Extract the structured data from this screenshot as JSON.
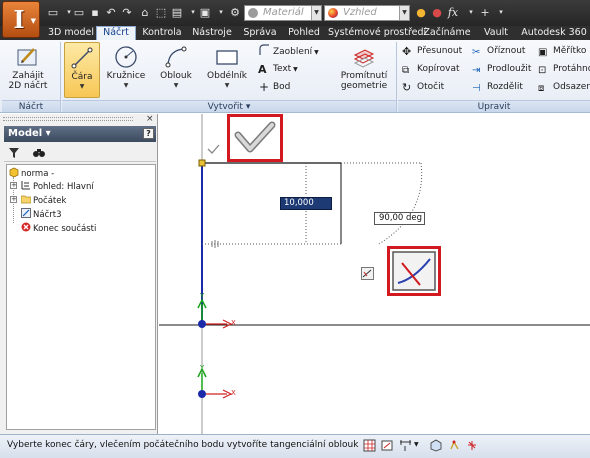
{
  "quick_access": {
    "app_logo": "I",
    "material_placeholder": "Materiál",
    "appearance_placeholder": "Vzhled",
    "fx_label": "fx"
  },
  "tabs": [
    "3D model",
    "Náčrt",
    "Kontrola",
    "Nástroje",
    "Správa",
    "Pohled",
    "Systémové prostředí",
    "Začínáme",
    "Vault",
    "Autodesk 360"
  ],
  "active_tab": "Náčrt",
  "ribbon": {
    "sketch_panel": {
      "title": "Náčrt",
      "start_sketch_line1": "Zahájit",
      "start_sketch_line2": "2D náčrt"
    },
    "create_panel": {
      "title": "Vytvořit",
      "line": "Čára",
      "circle": "Kružnice",
      "arc": "Oblouk",
      "rectangle": "Obdélník",
      "fillet": "Zaoblení",
      "text": "Text",
      "point": "Bod",
      "project_geometry_line1": "Promítnutí",
      "project_geometry_line2": "geometrie"
    },
    "modify_panel": {
      "title": "Upravit",
      "move": "Přesunout",
      "copy": "Kopírovat",
      "rotate": "Otočit",
      "trim": "Oříznout",
      "extend": "Prodloužit",
      "split": "Rozdělit",
      "scale": "Měřítko",
      "stretch": "Protáhno",
      "offset": "Odsazen"
    }
  },
  "model_panel": {
    "title": "Model",
    "tree": [
      {
        "label": "norma -"
      },
      {
        "label": "Pohled: Hlavní"
      },
      {
        "label": "Počátek"
      },
      {
        "label": "Náčrt3"
      },
      {
        "label": "Konec součásti"
      }
    ]
  },
  "canvas": {
    "length_input": "10,000 mm",
    "angle_display": "90,00 deg",
    "axis_x": "X",
    "axis_y": "Y"
  },
  "status_bar": {
    "message": "Vyberte konec čáry, vlečením počátečního bodu vytvoříte tangenciální oblouk"
  },
  "colors": {
    "app_button": "#d9682a",
    "active_tab": "#eef3fa",
    "selected_tool": "#f7c755",
    "sketch_line": "#1b2aa8",
    "highlight_frame": "#d2191f",
    "axis_x": "#d02020",
    "axis_y": "#1aa51a"
  }
}
